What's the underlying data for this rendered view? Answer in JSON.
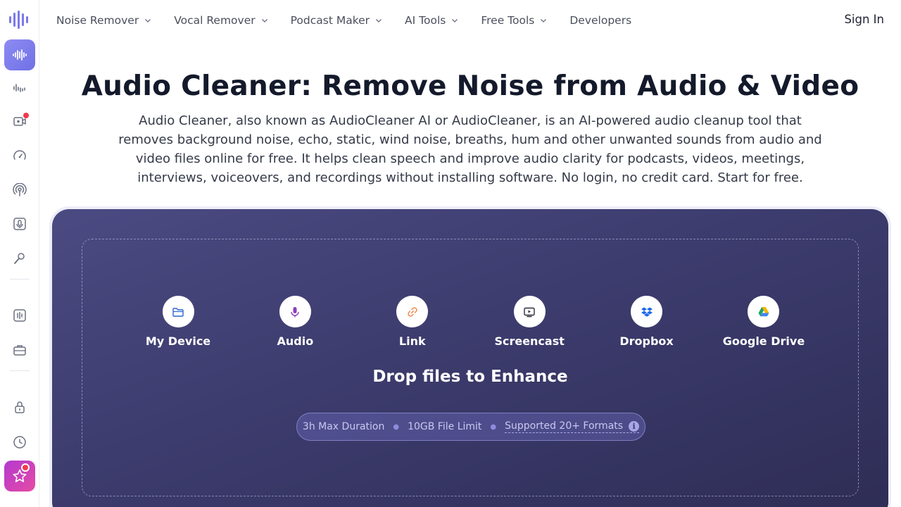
{
  "colors": {
    "accent": "#7a79ea",
    "card_bg": "#3b3a6b",
    "title": "#141a2b",
    "badge": "#ef3b4c"
  },
  "sidebar": {
    "items": [
      {
        "icon": "waveform-icon",
        "active": true
      },
      {
        "icon": "audio-bars-icon"
      },
      {
        "icon": "video-voice-icon",
        "badge": true
      },
      {
        "icon": "speed-gauge-icon"
      },
      {
        "icon": "podcast-icon"
      },
      {
        "icon": "microphone-icon"
      },
      {
        "icon": "voice-user-icon"
      },
      {
        "icon": "equalizer-icon"
      },
      {
        "icon": "briefcase-icon"
      },
      {
        "icon": "lock-icon"
      },
      {
        "icon": "clock-icon"
      },
      {
        "icon": "star-icon",
        "promo": true
      }
    ]
  },
  "nav": {
    "items": [
      {
        "label": "Noise Remover",
        "dropdown": true
      },
      {
        "label": "Vocal Remover",
        "dropdown": true
      },
      {
        "label": "Podcast Maker",
        "dropdown": true
      },
      {
        "label": "AI Tools",
        "dropdown": true
      },
      {
        "label": "Free Tools",
        "dropdown": true
      },
      {
        "label": "Developers",
        "dropdown": false
      }
    ],
    "sign_in": "Sign In"
  },
  "hero": {
    "title": "Audio Cleaner: Remove Noise from Audio & Video",
    "description": "Audio Cleaner, also known as AudioCleaner AI or AudioCleaner, is an AI-powered audio cleanup tool that removes background noise, echo, static, wind noise, breaths, hum and other unwanted sounds from audio and video files online for free. It helps clean speech and improve audio clarity for podcasts, videos, meetings, interviews, voiceovers, and recordings without installing software. No login, no credit card. Start for free."
  },
  "upload": {
    "sources": [
      {
        "label": "My Device",
        "icon": "folder-icon"
      },
      {
        "label": "Audio",
        "icon": "microphone-icon"
      },
      {
        "label": "Link",
        "icon": "link-icon"
      },
      {
        "label": "Screencast",
        "icon": "screencast-icon"
      },
      {
        "label": "Dropbox",
        "icon": "dropbox-icon"
      },
      {
        "label": "Google Drive",
        "icon": "google-drive-icon"
      }
    ],
    "drop_title": "Drop files to Enhance",
    "limits": {
      "duration": "3h Max Duration",
      "size": "10GB File Limit",
      "formats": "Supported 20+ Formats",
      "info_glyph": "i"
    }
  }
}
